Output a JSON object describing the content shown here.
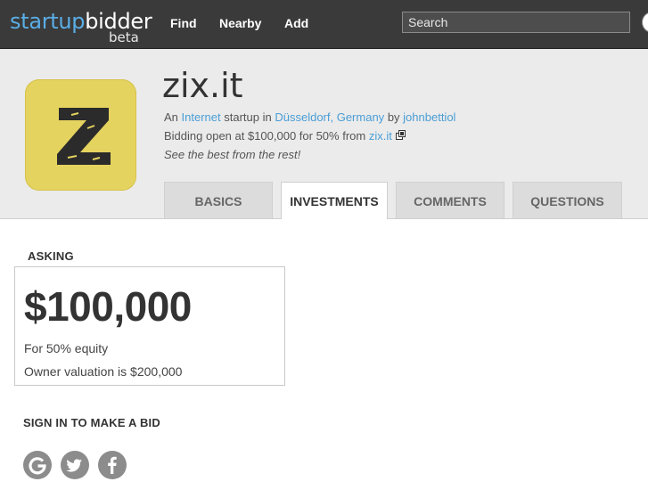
{
  "topbar": {
    "logo_part1": "startup",
    "logo_part2": "bidder",
    "logo_sub": "beta",
    "nav": [
      "Find",
      "Nearby",
      "Add"
    ],
    "search_placeholder": "Search"
  },
  "startup": {
    "name": "zix.it",
    "logo_letter": "Z",
    "line1": {
      "prefix": "An",
      "category": "Internet",
      "mid": "startup in",
      "location": "Düsseldorf, Germany",
      "by": "by",
      "owner": "johnbettiol"
    },
    "line2": {
      "text": "Bidding open at $100,000 for 50% from",
      "link": "zix.it"
    },
    "tagline": "See the best from the rest!"
  },
  "tabs": [
    {
      "label": "BASICS",
      "active": false
    },
    {
      "label": "INVESTMENTS",
      "active": true
    },
    {
      "label": "COMMENTS",
      "active": false
    },
    {
      "label": "QUESTIONS",
      "active": false
    }
  ],
  "asking": {
    "heading": "ASKING",
    "amount": "$100,000",
    "equity": "For 50% equity",
    "valuation": "Owner valuation is $200,000"
  },
  "signin": {
    "heading": "SIGN IN TO MAKE A BID",
    "providers": [
      "google-icon",
      "twitter-icon",
      "facebook-icon"
    ]
  },
  "colors": {
    "topbar": "#3a3a3a",
    "accent_link": "#4a9ed6",
    "logo_blue": "#5aaee6",
    "app_logo_bg": "#e5d35f",
    "header_bg": "#ebebeb",
    "social_bg": "#8c8c8c"
  }
}
